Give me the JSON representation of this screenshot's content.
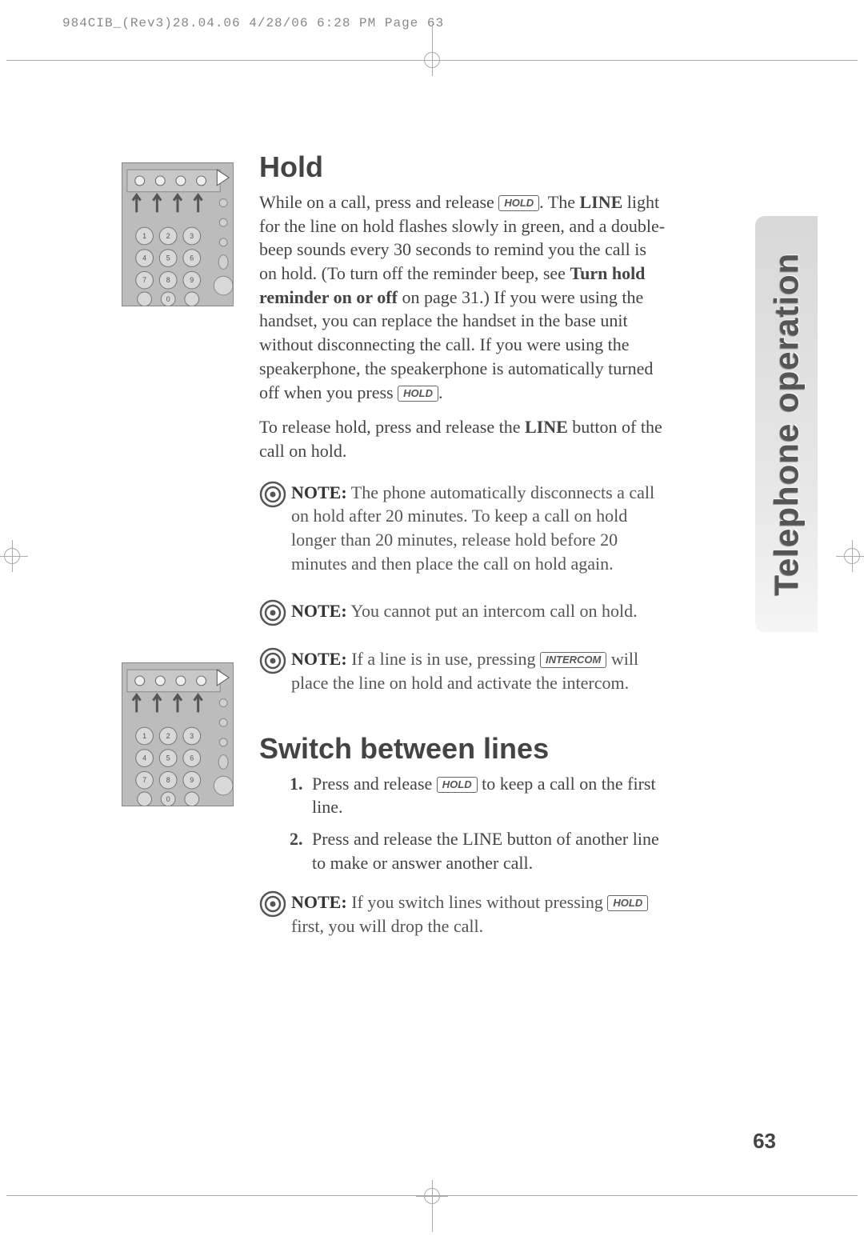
{
  "header": "984CIB_(Rev3)28.04.06  4/28/06  6:28 PM  Page 63",
  "side_tab": "Telephone operation",
  "page_number": "63",
  "sections": {
    "hold": {
      "title": "Hold",
      "p1a": "While on a call, press and release ",
      "p1b": ". The ",
      "p1c": "LINE",
      "p1d": " light for the line on hold flashes slowly in green, and a double-beep sounds every 30 seconds to remind you the call is on hold. (To turn off the reminder beep, see ",
      "p1e": "Turn hold reminder on or off",
      "p1f": " on page 31.)  If you were using the handset, you can replace the handset in the base unit without disconnecting the call.  If you were using the speakerphone, the speakerphone is automatically turned off when you press ",
      "p1g": ".",
      "p2a": "To release hold,  press and release the ",
      "p2b": "LINE",
      "p2c": " button of the call on hold."
    },
    "notes": {
      "label": "NOTE:",
      "n1": "  The phone automatically disconnects a call on hold after 20 minutes.  To keep a call on hold longer than 20 minutes, release hold before 20 minutes and then place the call on hold again.",
      "n2": "  You cannot put an intercom call on hold.",
      "n3a": "  If a line is in use, pressing ",
      "n3b": " will place the line on hold and activate the intercom.",
      "n4a": "  If you switch lines without pressing ",
      "n4b": " first, you will drop the call."
    },
    "switch": {
      "title": "Switch between lines",
      "s1a": "Press and release ",
      "s1b": " to keep a call on the first line.",
      "s2": "Press and release the LINE button of another line to make or answer another call."
    }
  },
  "keys": {
    "hold": "HOLD",
    "intercom": "INTERCOM"
  },
  "list_numbers": {
    "one": "1.",
    "two": "2."
  }
}
